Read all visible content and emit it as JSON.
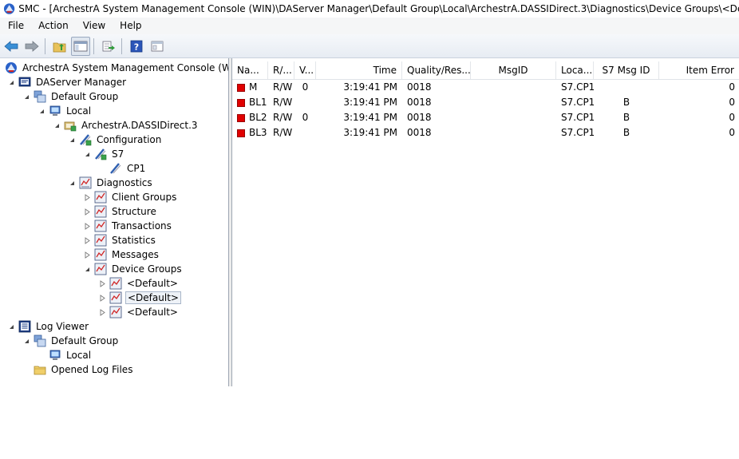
{
  "window": {
    "title": "SMC - [ArchestrA System Management Console (WIN)\\DAServer Manager\\Default Group\\Local\\ArchestrA.DASSIDirect.3\\Diagnostics\\Device Groups\\<Default>]"
  },
  "menu": [
    "File",
    "Action",
    "View",
    "Help"
  ],
  "colors": {
    "status_red": "#e00000",
    "toolbar_bg": "#e7ecf3"
  },
  "tree": {
    "root": "ArchestrA System Management Console (WIN)",
    "daserver_manager": "DAServer Manager",
    "default_group": "Default Group",
    "local": "Local",
    "archestra_node": "ArchestrA.DASSIDirect.3",
    "configuration": "Configuration",
    "s7": "S7",
    "cp1": "CP1",
    "diagnostics": "Diagnostics",
    "client_groups": "Client Groups",
    "structure": "Structure",
    "transactions": "Transactions",
    "statistics": "Statistics",
    "messages": "Messages",
    "device_groups": "Device Groups",
    "default_1": "<Default>",
    "default_2": "<Default>",
    "default_3": "<Default>",
    "log_viewer": "Log Viewer",
    "log_default_group": "Default Group",
    "log_local": "Local",
    "opened_log_files": "Opened Log Files"
  },
  "list": {
    "columns": [
      "Na...",
      "R/...",
      "V...",
      "Time",
      "Quality/Res...",
      "MsgID",
      "Loca...",
      "S7 Msg ID",
      "Item Error"
    ],
    "rows": [
      {
        "name": "M",
        "rw": "R/W",
        "v": "0",
        "time": "3:19:41 PM",
        "quality": "0018",
        "msgid": "",
        "loc": "S7.CP1",
        "s7msg": "",
        "err": "0"
      },
      {
        "name": "BL1",
        "rw": "R/W",
        "v": "",
        "time": "3:19:41 PM",
        "quality": "0018",
        "msgid": "",
        "loc": "S7.CP1",
        "s7msg": "B",
        "err": "0"
      },
      {
        "name": "BL2",
        "rw": "R/W",
        "v": "0",
        "time": "3:19:41 PM",
        "quality": "0018",
        "msgid": "",
        "loc": "S7.CP1",
        "s7msg": "B",
        "err": "0"
      },
      {
        "name": "BL3",
        "rw": "R/W",
        "v": "",
        "time": "3:19:41 PM",
        "quality": "0018",
        "msgid": "",
        "loc": "S7.CP1",
        "s7msg": "B",
        "err": "0"
      }
    ]
  }
}
